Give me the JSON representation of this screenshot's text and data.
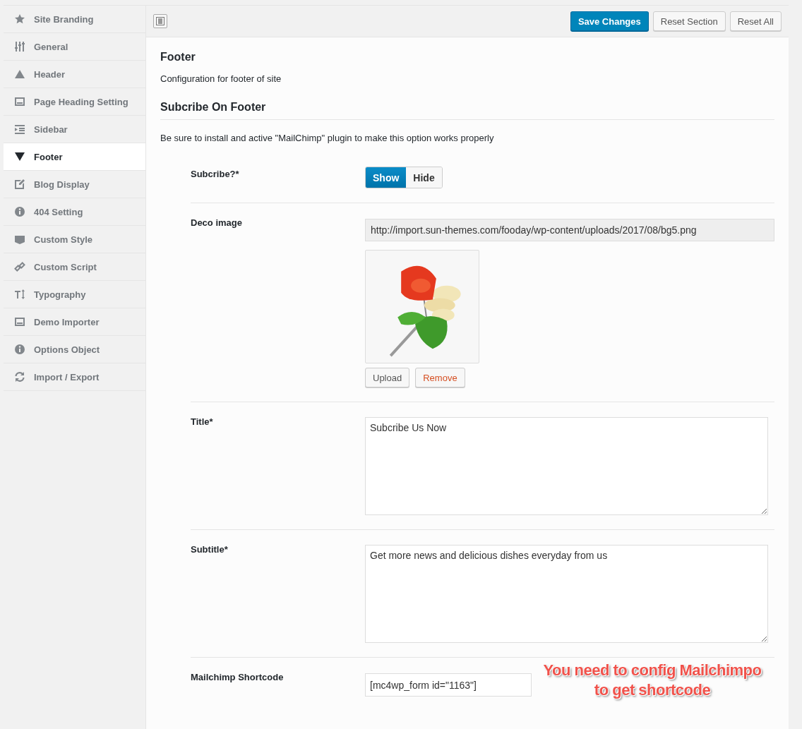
{
  "sidebar": {
    "items": [
      {
        "label": "Site Branding",
        "selected": false
      },
      {
        "label": "General",
        "selected": false
      },
      {
        "label": "Header",
        "selected": false
      },
      {
        "label": "Page Heading Setting",
        "selected": false
      },
      {
        "label": "Sidebar",
        "selected": false
      },
      {
        "label": "Footer",
        "selected": true
      },
      {
        "label": "Blog Display",
        "selected": false
      },
      {
        "label": "404 Setting",
        "selected": false
      },
      {
        "label": "Custom Style",
        "selected": false
      },
      {
        "label": "Custom Script",
        "selected": false
      },
      {
        "label": "Typography",
        "selected": false
      },
      {
        "label": "Demo Importer",
        "selected": false
      },
      {
        "label": "Options Object",
        "selected": false
      },
      {
        "label": "Import / Export",
        "selected": false
      }
    ]
  },
  "toolbar": {
    "buttons": [
      {
        "label": "Save Changes",
        "kind": "primary"
      },
      {
        "label": "Reset Section",
        "kind": "secondary"
      },
      {
        "label": "Reset All",
        "kind": "secondary"
      }
    ]
  },
  "section": {
    "title": "Footer",
    "description": "Configuration for footer of site",
    "subsection_title": "Subcribe On Footer",
    "subsection_description": "Be sure to install and active \"MailChimp\" plugin to make this option works properly"
  },
  "fields": [
    {
      "kind": "toggle",
      "label": "Subcribe?*",
      "options": [
        {
          "label": "Show",
          "selected": true
        },
        {
          "label": "Hide",
          "selected": false
        }
      ]
    },
    {
      "kind": "media",
      "label": "Deco image",
      "value": "http://import.sun-themes.com/fooday/wp-content/uploads/2017/08/bg5.png",
      "buttons": [
        "Upload",
        "Remove"
      ]
    },
    {
      "kind": "textarea",
      "label": "Title*",
      "value": "Subcribe Us Now"
    },
    {
      "kind": "textarea",
      "label": "Subtitle*",
      "value": "Get more news and delicious dishes everyday from us"
    },
    {
      "kind": "text",
      "label": "Mailchimp Shortcode",
      "value": "[mc4wp_form id=\"1163\"]",
      "annotation": "You need to config Mailchimpo to get shortcode"
    }
  ]
}
